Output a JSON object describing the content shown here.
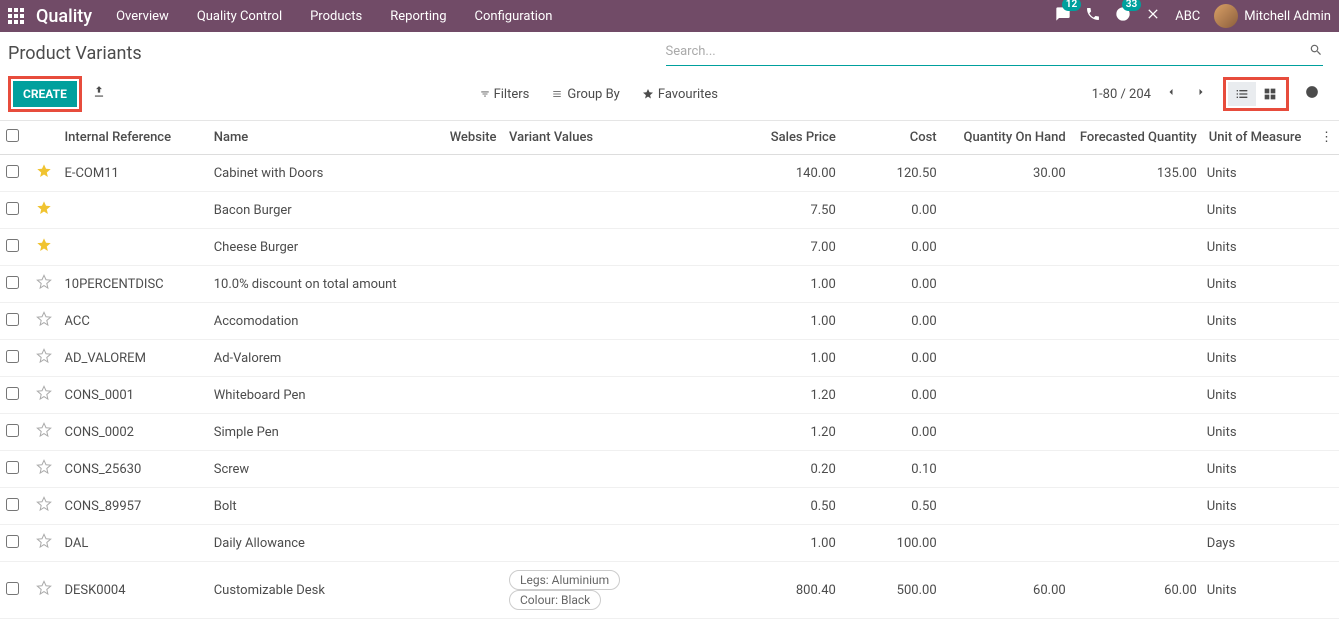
{
  "topbar": {
    "app_title": "Quality",
    "nav": [
      "Overview",
      "Quality Control",
      "Products",
      "Reporting",
      "Configuration"
    ],
    "chat_badge": "12",
    "clock_badge": "33",
    "company": "ABC",
    "user": "Mitchell Admin"
  },
  "page_title": "Product Variants",
  "search": {
    "placeholder": "Search..."
  },
  "buttons": {
    "create": "CREATE"
  },
  "tools": {
    "filters": "Filters",
    "group_by": "Group By",
    "favourites": "Favourites"
  },
  "pager": {
    "range": "1-80 / 204"
  },
  "columns": {
    "internal_reference": "Internal Reference",
    "name": "Name",
    "website": "Website",
    "variant_values": "Variant Values",
    "sales_price": "Sales Price",
    "cost": "Cost",
    "quantity_on_hand": "Quantity On Hand",
    "forecasted_quantity": "Forecasted Quantity",
    "unit_of_measure": "Unit of Measure"
  },
  "rows": [
    {
      "fav": true,
      "ref": "E-COM11",
      "name": "Cabinet with Doors",
      "variants": [],
      "price": "140.00",
      "cost": "120.50",
      "qoh": "30.00",
      "forecast": "135.00",
      "uom": "Units"
    },
    {
      "fav": true,
      "ref": "",
      "name": "Bacon Burger",
      "variants": [],
      "price": "7.50",
      "cost": "0.00",
      "qoh": "",
      "forecast": "",
      "uom": "Units"
    },
    {
      "fav": true,
      "ref": "",
      "name": "Cheese Burger",
      "variants": [],
      "price": "7.00",
      "cost": "0.00",
      "qoh": "",
      "forecast": "",
      "uom": "Units"
    },
    {
      "fav": false,
      "ref": "10PERCENTDISC",
      "name": "10.0% discount on total amount",
      "variants": [],
      "price": "1.00",
      "cost": "0.00",
      "qoh": "",
      "forecast": "",
      "uom": "Units"
    },
    {
      "fav": false,
      "ref": "ACC",
      "name": "Accomodation",
      "variants": [],
      "price": "1.00",
      "cost": "0.00",
      "qoh": "",
      "forecast": "",
      "uom": "Units"
    },
    {
      "fav": false,
      "ref": "AD_VALOREM",
      "name": "Ad-Valorem",
      "variants": [],
      "price": "1.00",
      "cost": "0.00",
      "qoh": "",
      "forecast": "",
      "uom": "Units"
    },
    {
      "fav": false,
      "ref": "CONS_0001",
      "name": "Whiteboard Pen",
      "variants": [],
      "price": "1.20",
      "cost": "0.00",
      "qoh": "",
      "forecast": "",
      "uom": "Units"
    },
    {
      "fav": false,
      "ref": "CONS_0002",
      "name": "Simple Pen",
      "variants": [],
      "price": "1.20",
      "cost": "0.00",
      "qoh": "",
      "forecast": "",
      "uom": "Units"
    },
    {
      "fav": false,
      "ref": "CONS_25630",
      "name": "Screw",
      "variants": [],
      "price": "0.20",
      "cost": "0.10",
      "qoh": "",
      "forecast": "",
      "uom": "Units"
    },
    {
      "fav": false,
      "ref": "CONS_89957",
      "name": "Bolt",
      "variants": [],
      "price": "0.50",
      "cost": "0.50",
      "qoh": "",
      "forecast": "",
      "uom": "Units"
    },
    {
      "fav": false,
      "ref": "DAL",
      "name": "Daily Allowance",
      "variants": [],
      "price": "1.00",
      "cost": "100.00",
      "qoh": "",
      "forecast": "",
      "uom": "Days"
    },
    {
      "fav": false,
      "ref": "DESK0004",
      "name": "Customizable Desk",
      "variants": [
        "Legs: Aluminium",
        "Colour: Black"
      ],
      "price": "800.40",
      "cost": "500.00",
      "qoh": "60.00",
      "forecast": "60.00",
      "uom": "Units"
    }
  ]
}
